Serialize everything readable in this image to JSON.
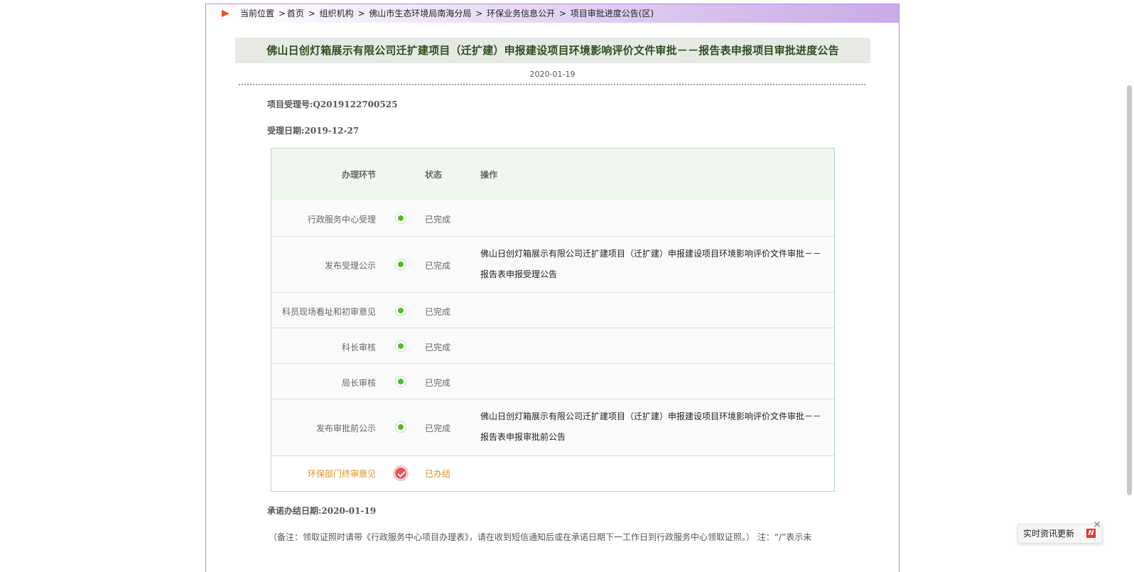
{
  "breadcrumb": {
    "label": "当前位置",
    "items": [
      "首页",
      "组织机构",
      "佛山市生态环境局南海分局",
      "环保业务信息公开",
      "项目审批进度公告(区)"
    ]
  },
  "article": {
    "title": "佛山日创灯箱展示有限公司迁扩建项目（迁扩建）申报建设项目环境影响评价文件审批－－报告表申报项目审批进度公告",
    "date": "2020-01-19"
  },
  "meta": {
    "project_no": "项目受理号:Q2019122700525",
    "accept_date": "受理日期:2019-12-27",
    "commit_date": "承诺办结日期:2020-01-19"
  },
  "table": {
    "headers": {
      "step": "办理环节",
      "status": "状态",
      "operation": "操作"
    },
    "rows": [
      {
        "step": "行政服务中心受理",
        "status": "已完成",
        "operation": ""
      },
      {
        "step": "发布受理公示",
        "status": "已完成",
        "operation": "佛山日创灯箱展示有限公司迁扩建项目（迁扩建）申报建设项目环境影响评价文件审批－－报告表申报受理公告"
      },
      {
        "step": "科员现场看址和初审意见",
        "status": "已完成",
        "operation": ""
      },
      {
        "step": "科长审核",
        "status": "已完成",
        "operation": ""
      },
      {
        "step": "局长审核",
        "status": "已完成",
        "operation": ""
      },
      {
        "step": "发布审批前公示",
        "status": "已完成",
        "operation": "佛山日创灯箱展示有限公司迁扩建项目（迁扩建）申报建设项目环境影响评价文件审批－－报告表申报审批前公告"
      },
      {
        "step": "环保部门终审意见",
        "status": "已办结",
        "operation": ""
      }
    ]
  },
  "footnote": "（备注：领取证照时请带《行政服务中心项目办理表》，请在收到短信通知后或在承诺日期下一工作日到行政服务中心领取证照。） 注：“/”表示未",
  "news_widget": {
    "label": "实时资讯更新",
    "badge": "N"
  },
  "colors": {
    "accent": "#e8541a",
    "step_done": "#4fbf22",
    "step_final": "#e8525a",
    "final_text": "#e0901a",
    "frame_border": "#b58ad6"
  }
}
